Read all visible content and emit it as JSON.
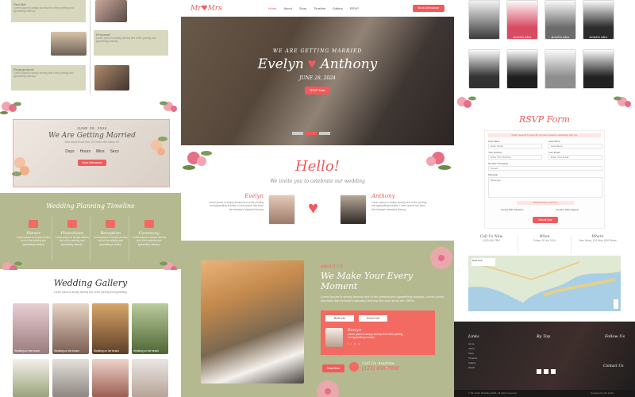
{
  "left": {
    "story": {
      "items": [
        {
          "title": "First Met",
          "text": "Lorem Ipsum is simply dummy text of the printing and typesetting industry."
        },
        {
          "title": "Proposal",
          "text": "Lorem Ipsum is simply dummy text of the printing and typesetting industry."
        },
        {
          "title": "Engagement",
          "text": "Lorem Ipsum is simply dummy text of the printing and typesetting industry."
        }
      ]
    },
    "countdown": {
      "date": "JUNE 28, 2024",
      "title": "We Are Getting Married",
      "address": "New Wood Road York, 123 Here USA Street, NY",
      "units": [
        "Days",
        "Hours",
        "Mins",
        "Secs"
      ],
      "button": "Book Attendance"
    },
    "planning": {
      "title": "Wedding Planning Timeline",
      "items": [
        {
          "name": "Dinner",
          "text": "Lorem Ipsum is simply dummy text of the printing and typesetting industry."
        },
        {
          "name": "Photoshoot",
          "text": "Lorem Ipsum is simply dummy text of the printing and typesetting industry."
        },
        {
          "name": "Reception",
          "text": "Lorem Ipsum is simply dummy text of the printing and typesetting industry."
        },
        {
          "name": "Ceremony",
          "text": "Lorem Ipsum is simply dummy text of the printing and typesetting industry."
        }
      ]
    },
    "gallery": {
      "title": "Wedding Gallery",
      "subtitle": "Lorem Ipsum is simply dummy text of the printing and typesetting",
      "captions": [
        "Wedding on the beach",
        "Wedding on the beach",
        "Wedding on the beach",
        "Wedding on the beach"
      ]
    }
  },
  "center": {
    "nav": {
      "logo": "Mr♥Mrs",
      "links": [
        "Home",
        "About",
        "Story",
        "Timeline",
        "Gallery",
        "RSVP"
      ],
      "cta": "Book Attendance"
    },
    "hero": {
      "tagline": "WE ARE GETTING MARRIED",
      "bride": "Evelyn",
      "groom": "Anthony",
      "date": "JUNE 28, 2024",
      "button": "RSVP Now"
    },
    "hello": {
      "title": "Hello!",
      "subtitle": "We invite you to celebrate our wedding",
      "bride_name": "Evelyn",
      "groom_name": "Anthony",
      "bride_text": "Lorem Ipsum is simply dummy text of the printing and typesetting industry. Lorem Ipsum has been the industry's standard dummy",
      "groom_text": "Lorem Ipsum is simply dummy text of the printing and typesetting industry. Lorem Ipsum has been the industry's standard dummy"
    },
    "about": {
      "eyebrow": "ABOUT US",
      "title": "We Make Your Every Moment",
      "text": "Lorem ipsum is simply dummy text of the printing and typesetting industry. Lorem Ipsum has been the industry's standard dummy text ever since the 1500s.",
      "tabs": [
        "Bride Info",
        "Groom Info"
      ],
      "card_name": "Evelyn",
      "card_text": "Lorem Ipsum is simply dummy text of the printing and typesetting industry.",
      "read_more": "Read More",
      "call_label": "Call Us Anytime",
      "phone": "(123) 456-7890"
    }
  },
  "right": {
    "party": [
      {
        "name": ""
      },
      {
        "name": "Amelia Alex"
      },
      {
        "name": "Amelia Alex"
      },
      {
        "name": "Amelia Alex"
      },
      {
        "name": ""
      },
      {
        "name": ""
      },
      {
        "name": ""
      },
      {
        "name": ""
      }
    ],
    "rsvp": {
      "title": "RSVP Form",
      "note": "Kindly respond by June 28, we look forward to celebrating with you",
      "labels": [
        "First Name",
        "Last Name",
        "Your Number",
        "Your Email",
        "Number Of Guests",
        "Message"
      ],
      "placeholders": [
        "Enter Name",
        "Last Name",
        "Enter Your Number",
        "Enter Your Email",
        "Guests",
        "Message"
      ],
      "options": [
        "Will attend the ceremony",
        "Will not attend"
      ],
      "checks": [
        "Accept With Pleasure",
        "Decline With Regrets"
      ],
      "submit": "Submit Now"
    },
    "contact": [
      {
        "label": "Call Us Now",
        "value": "(123) 456-7890"
      },
      {
        "label": "When",
        "value": "Friday, 28 Jun 2024"
      },
      {
        "label": "Where",
        "value": "New Wood, 123 Here USA Street"
      }
    ],
    "map": {
      "place": "New York"
    },
    "footer": {
      "cols": [
        "Links",
        "By Top",
        "Follow Us"
      ],
      "links": [
        "Home",
        "About",
        "Story",
        "Timeline",
        "Gallery",
        "RSVP"
      ],
      "contact_title": "Contact Us",
      "copyright": "© Mr & Mrs Wedding 2024, All rights reserved",
      "credit": "Designed by Mr & Mrs"
    }
  }
}
